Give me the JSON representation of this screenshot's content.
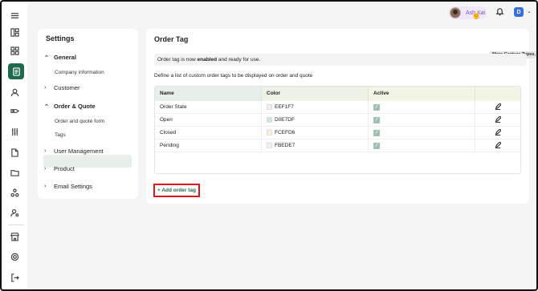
{
  "header": {
    "user_name": "Ash Kai",
    "account_initial": "D"
  },
  "settings": {
    "title": "Settings",
    "sections": [
      {
        "label": "General",
        "expanded": true,
        "items": [
          "Company information"
        ]
      },
      {
        "label": "Customer",
        "expanded": false
      },
      {
        "label": "Order & Quote",
        "expanded": true,
        "items": [
          "Order and quote form",
          "Tags"
        ]
      },
      {
        "label": "User Management",
        "expanded": false
      },
      {
        "label": "Product",
        "expanded": false
      },
      {
        "label": "Email Settings",
        "expanded": false
      }
    ],
    "active_item": "Tags"
  },
  "main": {
    "title": "Order Tag",
    "tooltip": "More Capture Types.",
    "notice_prefix": "Order tag is now ",
    "notice_status": "enabled",
    "notice_suffix": " and ready for use.",
    "description": "Define a list of custom order tags to be displayed on order and quote",
    "table": {
      "columns": [
        "Name",
        "Color",
        "Active",
        ""
      ],
      "rows": [
        {
          "name": "Order State",
          "color": "EEF1F7",
          "swatch": "#EEF1F7",
          "active": true
        },
        {
          "name": "Open",
          "color": "D0E7DF",
          "swatch": "#D0E7DF",
          "active": true
        },
        {
          "name": "Closed",
          "color": "FCEFD6",
          "swatch": "#FCEFD6",
          "active": true
        },
        {
          "name": "Pending",
          "color": "FBEDE7",
          "swatch": "#FBEDE7",
          "active": true
        }
      ]
    },
    "add_button": "+ Add order tag"
  },
  "colors": {
    "accent": "#1e6b4c",
    "highlight_border": "#e0141b",
    "user_chip": "#efe8fb",
    "badge": "#3a6fd8"
  },
  "icons": {
    "rail": [
      "menu-icon",
      "layout-icon",
      "grid-icon",
      "orders-icon",
      "user-icon",
      "tag-icon",
      "sliders-icon",
      "document-icon",
      "folder-icon",
      "network-icon",
      "user-settings-icon",
      "store-icon",
      "gear-icon",
      "logout-icon"
    ]
  }
}
